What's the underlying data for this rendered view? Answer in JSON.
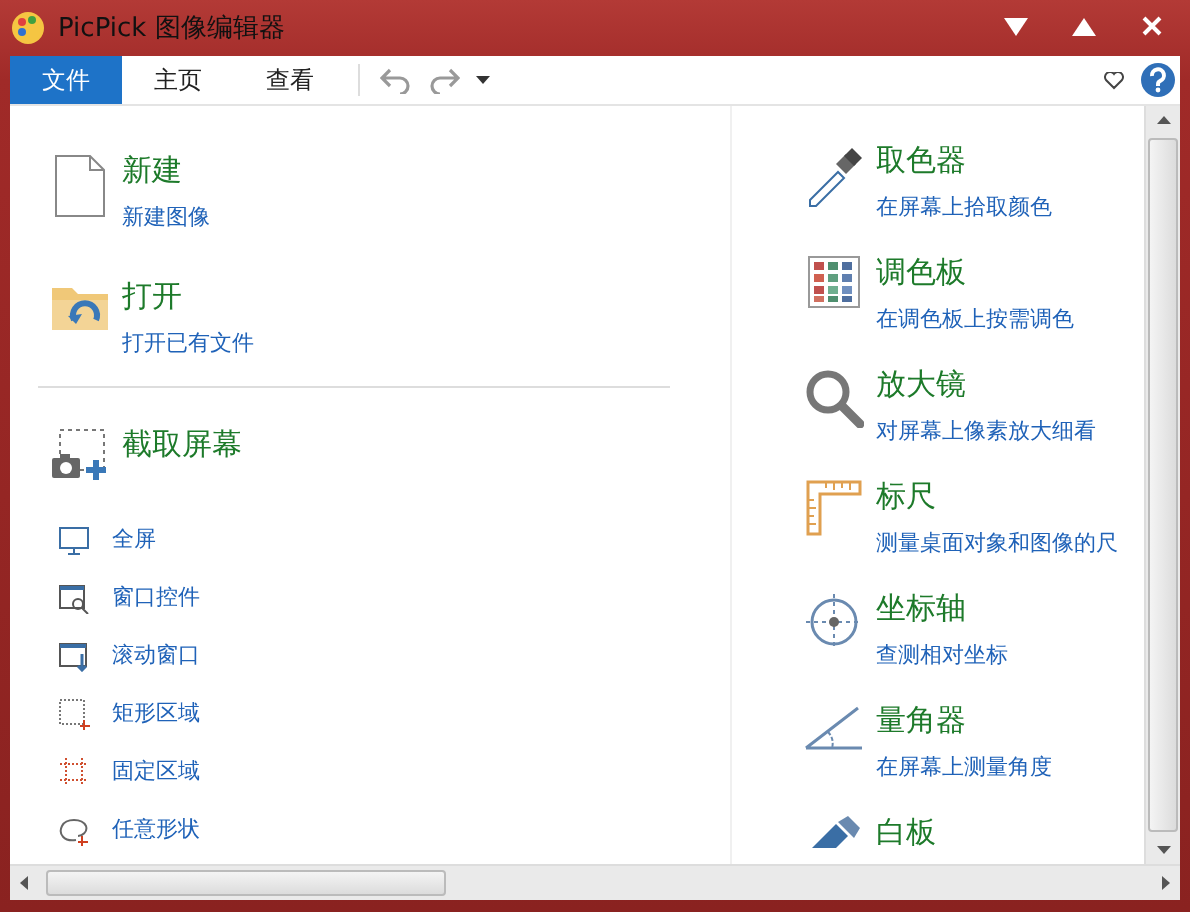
{
  "window": {
    "title": "PicPick 图像编辑器"
  },
  "tabs": [
    {
      "label": "文件",
      "selected": true
    },
    {
      "label": "主页",
      "selected": false
    },
    {
      "label": "查看",
      "selected": false
    }
  ],
  "left_items": [
    {
      "kind": "new",
      "title": "新建",
      "subtitle": "新建图像"
    },
    {
      "kind": "open",
      "title": "打开",
      "subtitle": "打开已有文件"
    }
  ],
  "capture": {
    "title": "截取屏幕",
    "options": [
      {
        "kind": "fullscreen",
        "label": "全屏"
      },
      {
        "kind": "window",
        "label": "窗口控件"
      },
      {
        "kind": "scroll",
        "label": "滚动窗口"
      },
      {
        "kind": "region",
        "label": "矩形区域"
      },
      {
        "kind": "fixed",
        "label": "固定区域"
      },
      {
        "kind": "freehand",
        "label": "任意形状"
      }
    ]
  },
  "right_items": [
    {
      "kind": "color-picker",
      "title": "取色器",
      "subtitle": "在屏幕上拾取颜色"
    },
    {
      "kind": "palette",
      "title": "调色板",
      "subtitle": "在调色板上按需调色"
    },
    {
      "kind": "magnifier",
      "title": "放大镜",
      "subtitle": "对屏幕上像素放大细看"
    },
    {
      "kind": "ruler",
      "title": "标尺",
      "subtitle": "测量桌面对象和图像的尺"
    },
    {
      "kind": "crosshair",
      "title": "坐标轴",
      "subtitle": "查测相对坐标"
    },
    {
      "kind": "protractor",
      "title": "量角器",
      "subtitle": "在屏幕上测量角度"
    },
    {
      "kind": "whiteboard",
      "title": "白板"
    }
  ]
}
